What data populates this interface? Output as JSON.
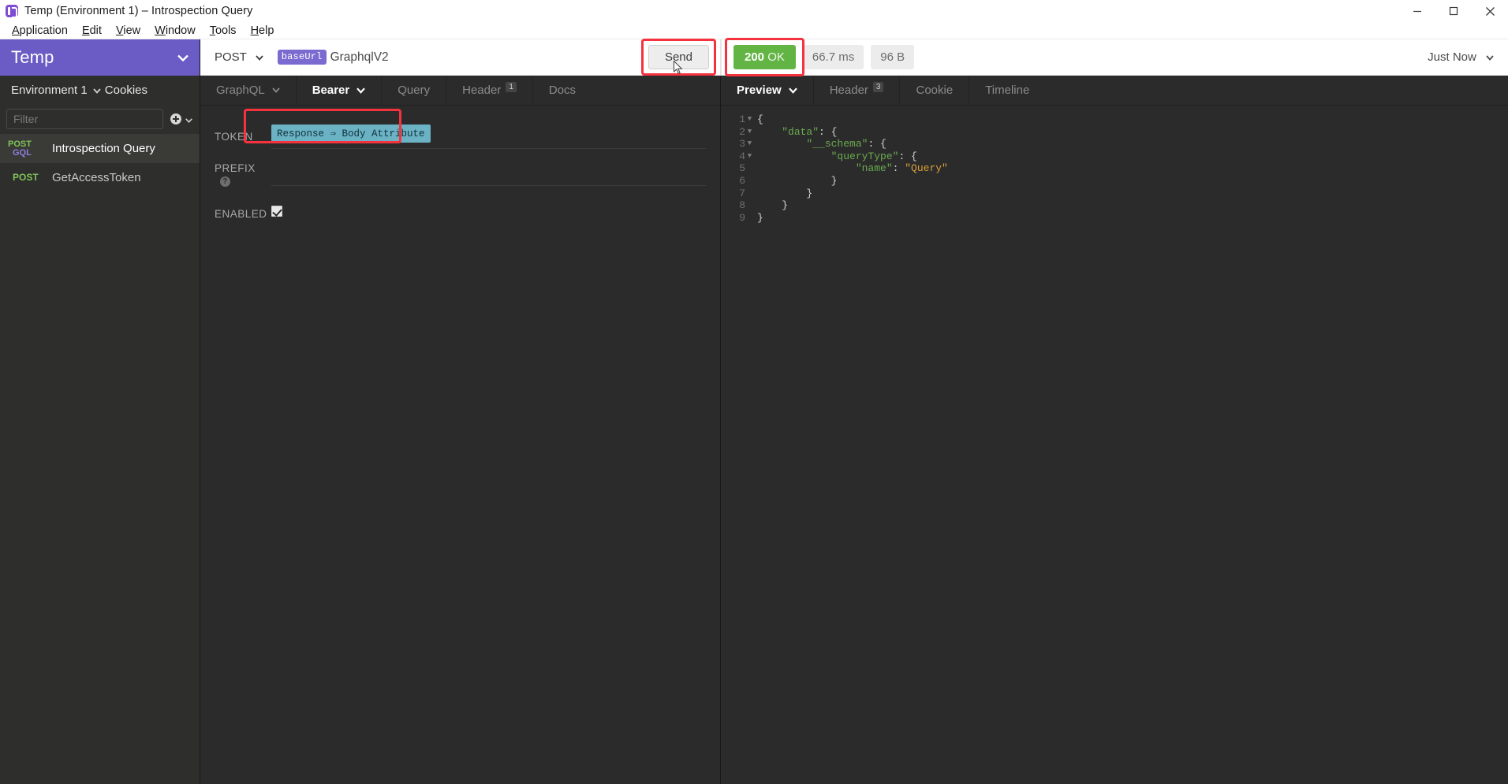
{
  "window": {
    "title": "Temp (Environment 1) – Introspection Query",
    "app_icon": "insomnia-icon",
    "minimize": "minimize-icon",
    "maximize": "maximize-icon",
    "close": "close-icon"
  },
  "menubar": [
    {
      "label": "Application",
      "accel": "A"
    },
    {
      "label": "Edit",
      "accel": "E"
    },
    {
      "label": "View",
      "accel": "V"
    },
    {
      "label": "Window",
      "accel": "W"
    },
    {
      "label": "Tools",
      "accel": "T"
    },
    {
      "label": "Help",
      "accel": "H"
    }
  ],
  "sidebar": {
    "workspace_name": "Temp",
    "workspace_caret": "chevron-down-icon",
    "environment": "Environment 1",
    "cookies_label": "Cookies",
    "filter_placeholder": "Filter",
    "filter_value": "",
    "add_button": "plus-circle-icon",
    "requests": [
      {
        "method_top": "POST",
        "method_bottom": "GQL",
        "name": "Introspection Query",
        "active": true
      },
      {
        "method_top": "POST",
        "method_bottom": "",
        "name": "GetAccessToken",
        "active": false
      }
    ]
  },
  "url_bar": {
    "method": "POST",
    "method_caret": "chevron-down-icon",
    "template_tag": "baseUrl",
    "url_text": "GraphqlV2",
    "send_label": "Send"
  },
  "status": {
    "code": "200",
    "code_text": "OK",
    "time": "66.7 ms",
    "size": "96 B",
    "history_label": "Just Now",
    "history_caret": "chevron-down-icon",
    "ok_color": "#62b544"
  },
  "request_tabs": [
    {
      "label": "GraphQL",
      "caret": true,
      "badge": "",
      "active": false
    },
    {
      "label": "Bearer",
      "caret": true,
      "badge": "",
      "active": true
    },
    {
      "label": "Query",
      "caret": false,
      "badge": "",
      "active": false
    },
    {
      "label": "Header",
      "caret": false,
      "badge": "1",
      "active": false
    },
    {
      "label": "Docs",
      "caret": false,
      "badge": "",
      "active": false
    }
  ],
  "auth_form": {
    "token_label": "TOKEN",
    "token_value": "Response ⇒ Body Attribute",
    "prefix_label": "PREFIX",
    "prefix_help": "help-icon",
    "prefix_value": "",
    "enabled_label": "ENABLED",
    "enabled_checked": true
  },
  "response_tabs": [
    {
      "label": "Preview",
      "caret": true,
      "badge": "",
      "active": true
    },
    {
      "label": "Header",
      "caret": false,
      "badge": "3",
      "active": false
    },
    {
      "label": "Cookie",
      "caret": false,
      "badge": "",
      "active": false
    },
    {
      "label": "Timeline",
      "caret": false,
      "badge": "",
      "active": false
    }
  ],
  "response_body": {
    "language": "json",
    "lines": [
      {
        "n": 1,
        "fold": true,
        "indent": 0,
        "parts": [
          {
            "t": "{",
            "c": "p"
          }
        ]
      },
      {
        "n": 2,
        "fold": true,
        "indent": 1,
        "parts": [
          {
            "t": "\"data\"",
            "c": "k"
          },
          {
            "t": ": {",
            "c": "p"
          }
        ]
      },
      {
        "n": 3,
        "fold": true,
        "indent": 2,
        "parts": [
          {
            "t": "\"__schema\"",
            "c": "k"
          },
          {
            "t": ": {",
            "c": "p"
          }
        ]
      },
      {
        "n": 4,
        "fold": true,
        "indent": 3,
        "parts": [
          {
            "t": "\"queryType\"",
            "c": "k"
          },
          {
            "t": ": {",
            "c": "p"
          }
        ]
      },
      {
        "n": 5,
        "fold": false,
        "indent": 4,
        "parts": [
          {
            "t": "\"name\"",
            "c": "k"
          },
          {
            "t": ": ",
            "c": "p"
          },
          {
            "t": "\"Query\"",
            "c": "s"
          }
        ]
      },
      {
        "n": 6,
        "fold": false,
        "indent": 3,
        "parts": [
          {
            "t": "}",
            "c": "p"
          }
        ]
      },
      {
        "n": 7,
        "fold": false,
        "indent": 2,
        "parts": [
          {
            "t": "}",
            "c": "p"
          }
        ]
      },
      {
        "n": 8,
        "fold": false,
        "indent": 1,
        "parts": [
          {
            "t": "}",
            "c": "p"
          }
        ]
      },
      {
        "n": 9,
        "fold": false,
        "indent": 0,
        "parts": [
          {
            "t": "}",
            "c": "p"
          }
        ]
      }
    ]
  },
  "annotations": {
    "color": "#f5333f",
    "targets": [
      "send-button",
      "status-code-badge",
      "token-field"
    ]
  }
}
